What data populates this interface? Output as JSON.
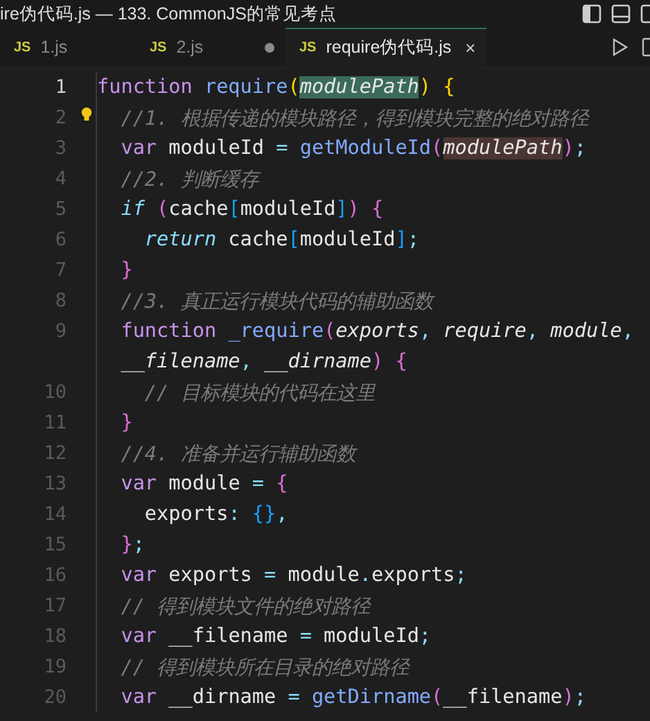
{
  "window": {
    "title": "ire伪代码.js — 133. CommonJS的常见考点"
  },
  "tabs": [
    {
      "badge": "JS",
      "label": "1.js",
      "selected": false,
      "modified": false
    },
    {
      "badge": "JS",
      "label": "2.js",
      "selected": false,
      "modified": true
    },
    {
      "badge": "JS",
      "label": "require伪代码.js",
      "close": "×",
      "selected": true,
      "modified": false
    }
  ],
  "editor": {
    "lines": [
      {
        "number": "1",
        "tokens": [
          {
            "kind": "keyword",
            "text": "function "
          },
          {
            "kind": "function",
            "text": "require"
          },
          {
            "kind": "bracket1",
            "text": "("
          },
          {
            "kind": "param-selected",
            "text": "modulePath"
          },
          {
            "kind": "bracket1",
            "text": ") {"
          }
        ]
      },
      {
        "number": "2",
        "lightbulb": true,
        "tokens": [
          {
            "kind": "comment",
            "text": "  //1. 根据传递的模块路径，得到模块完整的绝对路径"
          }
        ]
      },
      {
        "number": "3",
        "tokens": [
          {
            "kind": "keyword",
            "text": "  var"
          },
          {
            "kind": "plain",
            "text": " moduleId "
          },
          {
            "kind": "op",
            "text": "= "
          },
          {
            "kind": "function",
            "text": "getModuleId"
          },
          {
            "kind": "bracket2",
            "text": "("
          },
          {
            "kind": "param-occurrence",
            "text": "modulePath"
          },
          {
            "kind": "bracket2",
            "text": ")"
          },
          {
            "kind": "op",
            "text": ";"
          }
        ]
      },
      {
        "number": "4",
        "tokens": [
          {
            "kind": "comment",
            "text": "  //2. 判断缓存"
          }
        ]
      },
      {
        "number": "5",
        "tokens": [
          {
            "kind": "control",
            "text": "  if "
          },
          {
            "kind": "bracket2",
            "text": "("
          },
          {
            "kind": "plain",
            "text": "cache"
          },
          {
            "kind": "bracket3",
            "text": "["
          },
          {
            "kind": "plain",
            "text": "moduleId"
          },
          {
            "kind": "bracket3",
            "text": "]"
          },
          {
            "kind": "bracket2",
            "text": ") {"
          }
        ]
      },
      {
        "number": "6",
        "tokens": [
          {
            "kind": "control",
            "text": "    return"
          },
          {
            "kind": "plain",
            "text": " cache"
          },
          {
            "kind": "bracket3",
            "text": "["
          },
          {
            "kind": "plain",
            "text": "moduleId"
          },
          {
            "kind": "bracket3",
            "text": "]"
          },
          {
            "kind": "op",
            "text": ";"
          }
        ]
      },
      {
        "number": "7",
        "tokens": [
          {
            "kind": "bracket2",
            "text": "  }"
          }
        ]
      },
      {
        "number": "8",
        "tokens": [
          {
            "kind": "comment",
            "text": "  //3. 真正运行模块代码的辅助函数"
          }
        ]
      },
      {
        "number": "9",
        "tokens": [
          {
            "kind": "keyword",
            "text": "  function "
          },
          {
            "kind": "function",
            "text": "_require"
          },
          {
            "kind": "bracket2",
            "text": "("
          },
          {
            "kind": "param",
            "text": "exports"
          },
          {
            "kind": "op",
            "text": ", "
          },
          {
            "kind": "param",
            "text": "require"
          },
          {
            "kind": "op",
            "text": ", "
          },
          {
            "kind": "param",
            "text": "module"
          },
          {
            "kind": "op",
            "text": ","
          }
        ]
      },
      {
        "tokens": [
          {
            "kind": "param",
            "text": "  __filename"
          },
          {
            "kind": "op",
            "text": ", "
          },
          {
            "kind": "param",
            "text": "__dirname"
          },
          {
            "kind": "bracket2",
            "text": ") {"
          }
        ]
      },
      {
        "number": "10",
        "tokens": [
          {
            "kind": "comment",
            "text": "    // 目标模块的代码在这里"
          }
        ]
      },
      {
        "number": "11",
        "tokens": [
          {
            "kind": "bracket2",
            "text": "  }"
          }
        ]
      },
      {
        "number": "12",
        "tokens": [
          {
            "kind": "comment",
            "text": "  //4. 准备并运行辅助函数"
          }
        ]
      },
      {
        "number": "13",
        "tokens": [
          {
            "kind": "keyword",
            "text": "  var"
          },
          {
            "kind": "plain",
            "text": " module "
          },
          {
            "kind": "op",
            "text": "= "
          },
          {
            "kind": "bracket2",
            "text": "{"
          }
        ]
      },
      {
        "number": "14",
        "tokens": [
          {
            "kind": "plain",
            "text": "    exports"
          },
          {
            "kind": "op",
            "text": ": "
          },
          {
            "kind": "bracket3",
            "text": "{}"
          },
          {
            "kind": "op",
            "text": ","
          }
        ]
      },
      {
        "number": "15",
        "tokens": [
          {
            "kind": "bracket2",
            "text": "  }"
          },
          {
            "kind": "op",
            "text": ";"
          }
        ]
      },
      {
        "number": "16",
        "tokens": [
          {
            "kind": "keyword",
            "text": "  var"
          },
          {
            "kind": "plain",
            "text": " exports "
          },
          {
            "kind": "op",
            "text": "="
          },
          {
            "kind": "plain",
            "text": " module"
          },
          {
            "kind": "op",
            "text": "."
          },
          {
            "kind": "plain",
            "text": "exports"
          },
          {
            "kind": "op",
            "text": ";"
          }
        ]
      },
      {
        "number": "17",
        "tokens": [
          {
            "kind": "comment",
            "text": "  // 得到模块文件的绝对路径"
          }
        ]
      },
      {
        "number": "18",
        "tokens": [
          {
            "kind": "keyword",
            "text": "  var"
          },
          {
            "kind": "plain",
            "text": " __filename "
          },
          {
            "kind": "op",
            "text": "="
          },
          {
            "kind": "plain",
            "text": " moduleId"
          },
          {
            "kind": "op",
            "text": ";"
          }
        ]
      },
      {
        "number": "19",
        "tokens": [
          {
            "kind": "comment",
            "text": "  // 得到模块所在目录的绝对路径"
          }
        ]
      },
      {
        "number": "20",
        "tokens": [
          {
            "kind": "keyword",
            "text": "  var"
          },
          {
            "kind": "plain",
            "text": " __dirname "
          },
          {
            "kind": "op",
            "text": "= "
          },
          {
            "kind": "function",
            "text": "getDirname"
          },
          {
            "kind": "bracket2",
            "text": "("
          },
          {
            "kind": "plain",
            "text": "__filename"
          },
          {
            "kind": "bracket2",
            "text": ")"
          },
          {
            "kind": "op",
            "text": ";"
          }
        ]
      }
    ]
  }
}
